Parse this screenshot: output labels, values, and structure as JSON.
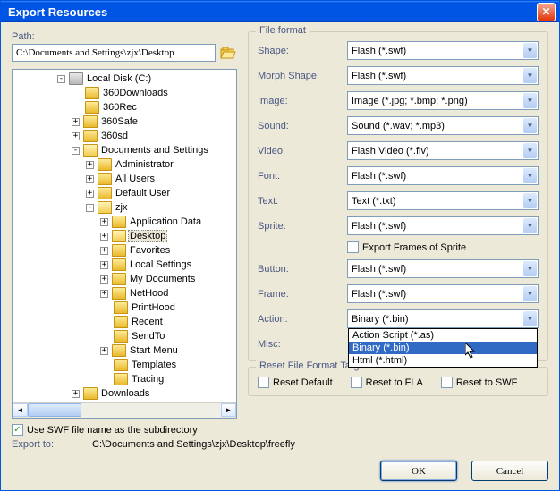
{
  "title": "Export Resources",
  "path": {
    "label": "Path:",
    "value": "C:\\Documents and Settings\\zjx\\Desktop"
  },
  "tree": [
    {
      "indent": 48,
      "exp": "-",
      "icon": "drive",
      "label": "Local Disk (C:)"
    },
    {
      "indent": 64,
      "exp": "",
      "icon": "folder",
      "label": "360Downloads"
    },
    {
      "indent": 64,
      "exp": "",
      "icon": "folder",
      "label": "360Rec"
    },
    {
      "indent": 64,
      "exp": "+",
      "icon": "folder",
      "label": "360Safe"
    },
    {
      "indent": 64,
      "exp": "+",
      "icon": "folder",
      "label": "360sd"
    },
    {
      "indent": 64,
      "exp": "-",
      "icon": "folder-open",
      "label": "Documents and Settings"
    },
    {
      "indent": 80,
      "exp": "+",
      "icon": "folder",
      "label": "Administrator"
    },
    {
      "indent": 80,
      "exp": "+",
      "icon": "folder",
      "label": "All Users"
    },
    {
      "indent": 80,
      "exp": "+",
      "icon": "folder",
      "label": "Default User"
    },
    {
      "indent": 80,
      "exp": "-",
      "icon": "folder-open",
      "label": "zjx"
    },
    {
      "indent": 96,
      "exp": "+",
      "icon": "folder",
      "label": "Application Data"
    },
    {
      "indent": 96,
      "exp": "+",
      "icon": "folder-open",
      "label": "Desktop",
      "selected": true
    },
    {
      "indent": 96,
      "exp": "+",
      "icon": "folder",
      "label": "Favorites"
    },
    {
      "indent": 96,
      "exp": "+",
      "icon": "folder",
      "label": "Local Settings"
    },
    {
      "indent": 96,
      "exp": "+",
      "icon": "folder",
      "label": "My Documents"
    },
    {
      "indent": 96,
      "exp": "+",
      "icon": "folder",
      "label": "NetHood"
    },
    {
      "indent": 96,
      "exp": "",
      "icon": "folder",
      "label": "PrintHood"
    },
    {
      "indent": 96,
      "exp": "",
      "icon": "folder",
      "label": "Recent"
    },
    {
      "indent": 96,
      "exp": "",
      "icon": "folder",
      "label": "SendTo"
    },
    {
      "indent": 96,
      "exp": "+",
      "icon": "folder",
      "label": "Start Menu"
    },
    {
      "indent": 96,
      "exp": "",
      "icon": "folder",
      "label": "Templates"
    },
    {
      "indent": 96,
      "exp": "",
      "icon": "folder",
      "label": "Tracing"
    },
    {
      "indent": 64,
      "exp": "+",
      "icon": "folder",
      "label": "Downloads"
    }
  ],
  "file_format": {
    "legend": "File format",
    "rows": [
      {
        "key": "shape",
        "label": "Shape:",
        "value": "Flash (*.swf)"
      },
      {
        "key": "morph",
        "label": "Morph Shape:",
        "value": "Flash (*.swf)"
      },
      {
        "key": "image",
        "label": "Image:",
        "value": "Image (*.jpg; *.bmp; *.png)"
      },
      {
        "key": "sound",
        "label": "Sound:",
        "value": "Sound (*.wav; *.mp3)"
      },
      {
        "key": "video",
        "label": "Video:",
        "value": "Flash Video (*.flv)"
      },
      {
        "key": "font",
        "label": "Font:",
        "value": "Flash (*.swf)"
      },
      {
        "key": "text",
        "label": "Text:",
        "value": "Text (*.txt)"
      },
      {
        "key": "sprite",
        "label": "Sprite:",
        "value": "Flash (*.swf)"
      }
    ],
    "export_frames": "Export Frames of Sprite",
    "rows2": [
      {
        "key": "button",
        "label": "Button:",
        "value": "Flash (*.swf)"
      },
      {
        "key": "frame",
        "label": "Frame:",
        "value": "Flash (*.swf)"
      }
    ],
    "action": {
      "label": "Action:",
      "value": "Binary (*.bin)",
      "options": [
        "Action Script (*.as)",
        "Binary (*.bin)",
        "Html (*.html)"
      ],
      "highlighted": 1
    },
    "misc": {
      "label": "Misc:",
      "value": ""
    }
  },
  "reset": {
    "legend": "Reset File Format Target",
    "default": "Reset Default",
    "fla": "Reset to FLA",
    "swf": "Reset to SWF"
  },
  "subdir": {
    "checked": true,
    "label": "Use SWF file name as the subdirectory"
  },
  "export_to": {
    "label": "Export to:",
    "value": "C:\\Documents and Settings\\zjx\\Desktop\\freefly"
  },
  "buttons": {
    "ok": "OK",
    "cancel": "Cancel"
  }
}
